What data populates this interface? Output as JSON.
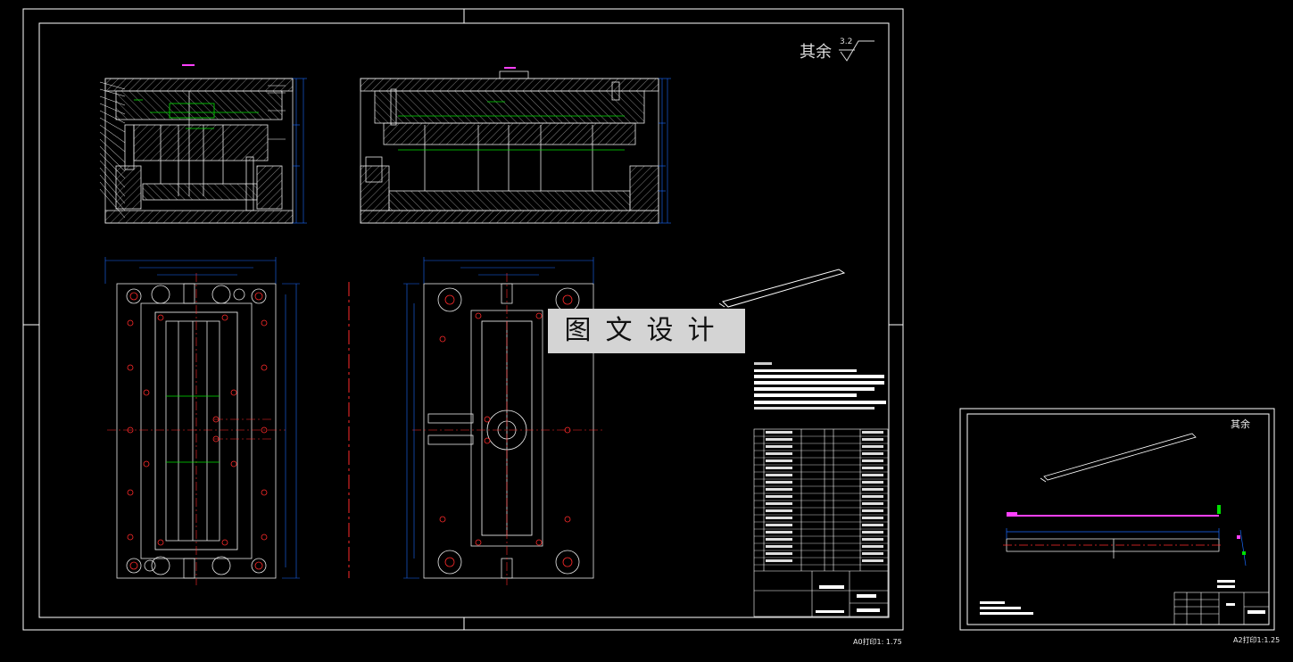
{
  "roughness_note": {
    "label": "其余",
    "value": "3.2"
  },
  "watermark": "图文设计",
  "sheet1_scale": "A0打印1: 1.75",
  "sheet2_scale": "A2打印1:1.25",
  "sheet2_roughness": "其余",
  "colors": {
    "background": "#000000",
    "frame": "#ffffff",
    "geometry": "#e8e8e8",
    "dimension": "#1a6bff",
    "centerline": "#ff2a2a",
    "parts": "#00e000",
    "callout": "#ff40ff",
    "watermark_bg": "#d4d4d4"
  }
}
